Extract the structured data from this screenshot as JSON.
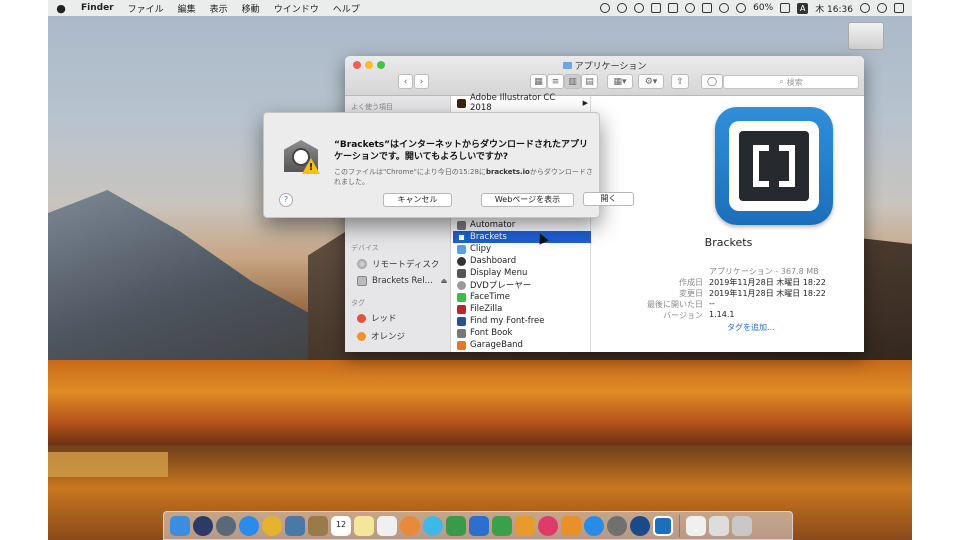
{
  "menubar": {
    "apple": "",
    "items": [
      "Finder",
      "ファイル",
      "編集",
      "表示",
      "移動",
      "ウインドウ",
      "ヘルプ"
    ],
    "battery": "60%",
    "input_method": "A",
    "clock": "木 16:36"
  },
  "finder": {
    "title": "アプリケーション",
    "search_placeholder": "検索",
    "sidebar": {
      "favorites_header": "よく使う項目",
      "devices_header": "デバイス",
      "remote_disc": "リモートディスク",
      "brackets_volume": "Brackets Rel...",
      "tags_header": "タグ",
      "tags": [
        {
          "label": "レッド",
          "color": "#e0533d"
        },
        {
          "label": "オレンジ",
          "color": "#f0922f"
        }
      ]
    },
    "files": [
      {
        "name": "Adobe Illustrator CC 2018",
        "icon_color": "#3a2410",
        "folder": true
      },
      {
        "name": "Automator",
        "icon_color": "#7a7a7a"
      },
      {
        "name": "Brackets",
        "icon_color": "#1c6fba",
        "selected": true
      },
      {
        "name": "Clipy",
        "icon_color": "#5aa0e0"
      },
      {
        "name": "Dashboard",
        "icon_color": "#333333"
      },
      {
        "name": "Display Menu",
        "icon_color": "#555555"
      },
      {
        "name": "DVDプレーヤー",
        "icon_color": "#9a9a9a"
      },
      {
        "name": "FaceTime",
        "icon_color": "#3dbb4f"
      },
      {
        "name": "FileZilla",
        "icon_color": "#b8262c"
      },
      {
        "name": "Find my Font-free",
        "icon_color": "#2e4f8f"
      },
      {
        "name": "Font Book",
        "icon_color": "#777777"
      },
      {
        "name": "GarageBand",
        "icon_color": "#e07b1e"
      }
    ],
    "preview": {
      "app_name": "Brackets",
      "info": [
        {
          "key": "",
          "value": "アプリケーション - 367.8 MB"
        },
        {
          "key": "作成日",
          "value": "2019年11月28日 木曜日 18:22"
        },
        {
          "key": "変更日",
          "value": "2019年11月28日 木曜日 18:22"
        },
        {
          "key": "最後に開いた日",
          "value": "--"
        },
        {
          "key": "バージョン",
          "value": "1.14.1"
        }
      ],
      "add_tags": "タグを追加..."
    }
  },
  "dialog": {
    "title": "“Brackets”はインターネットからダウンロードされたアプリケーションです。開いてもよろしいですか?",
    "sub_prefix": "このファイルは\"Chrome\"により今日の15:28に",
    "sub_domain": "brackets.io",
    "sub_suffix": "からダウンロードされました。",
    "help": "?",
    "cancel": "キャンセル",
    "show_web": "Webページを表示",
    "open": "開く"
  },
  "dock": {
    "calendar_day": "12"
  },
  "colors": {
    "selection": "#1f5ed5",
    "link": "#2a6bd1"
  }
}
